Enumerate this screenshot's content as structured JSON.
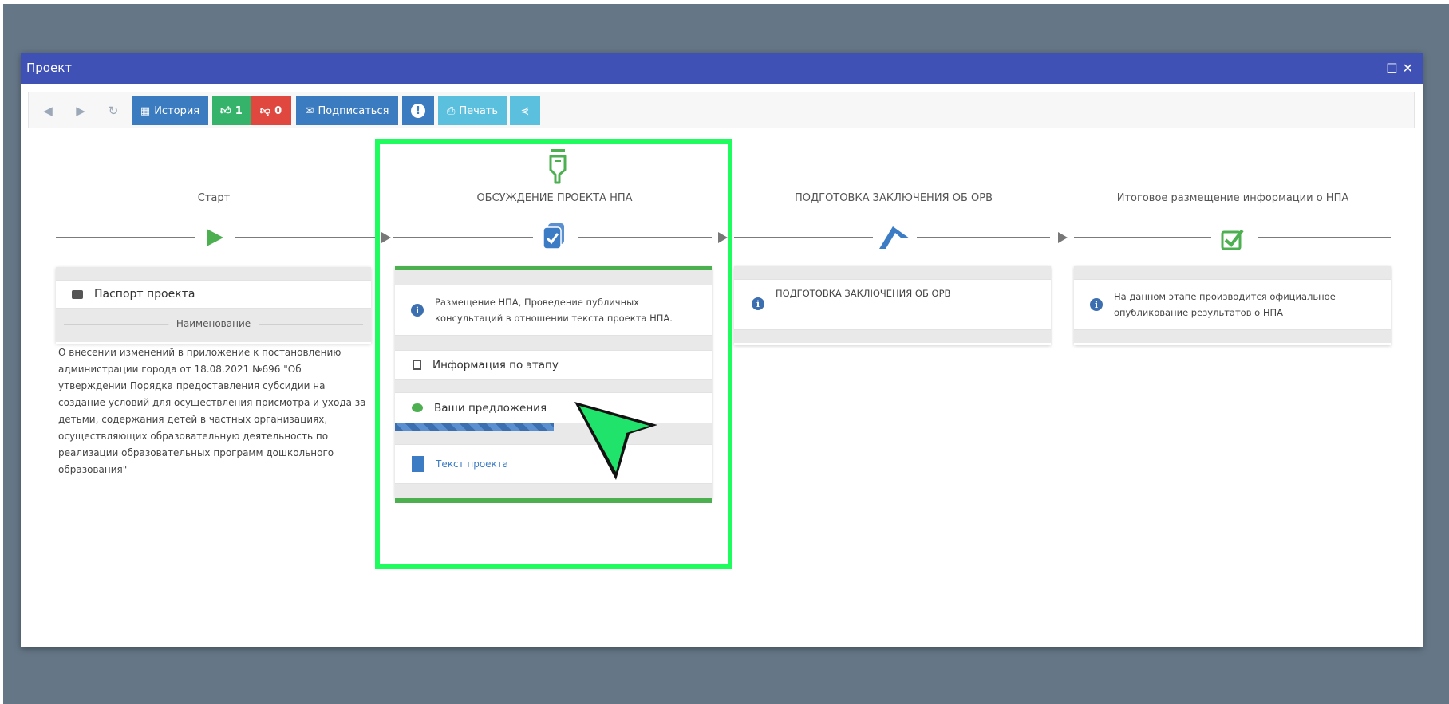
{
  "window": {
    "title": "Проект",
    "maximize_icon": "square-icon",
    "close_icon": "close-icon"
  },
  "toolbar": {
    "history_label": "История",
    "likes_count": "1",
    "dislikes_count": "0",
    "subscribe_label": "Подписаться",
    "print_label": "Печать"
  },
  "stages": [
    {
      "title": "Старт",
      "icon": "play-icon"
    },
    {
      "title": "ОБСУЖДЕНИЕ ПРОЕКТА НПА",
      "icon": "document-check-icon"
    },
    {
      "title": "ПОДГОТОВКА ЗАКЛЮЧЕНИЯ ОБ ОРВ",
      "icon": "flag-icon"
    },
    {
      "title": "Итоговое размещение информации о НПА",
      "icon": "checkbox-icon"
    }
  ],
  "start_card": {
    "passport_label": "Паспорт проекта",
    "section_label": "Наименование",
    "name_text": "О внесении изменений в приложение к постановлению администрации города от 18.08.2021 №696 \"Об утверждении Порядка предоставления субсидии на создание условий для осуществления присмотра и ухода за детьми, содержания детей в частных организациях, осуществляющих образовательную деятельность по реализации образовательных программ дошкольного образования\""
  },
  "discussion_card": {
    "info_text": "Размещение НПА, Проведение публичных консультаций в отношении текста проекта НПА.",
    "stage_info_label": "Информация по этапу",
    "proposals_label": "Ваши предложения",
    "proposals_progress": 0.5,
    "project_text_label": "Текст проекта"
  },
  "orv_card": {
    "info_text": "ПОДГОТОВКА ЗАКЛЮЧЕНИЯ ОБ ОРВ"
  },
  "final_card": {
    "info_text": "На данном этапе производится официальное опубликование результатов о НПА"
  },
  "colors": {
    "titlebar": "#3f51b5",
    "highlight": "#1efc5e",
    "stage_green": "#4caf50",
    "stage_blue": "#3c7cc4"
  }
}
